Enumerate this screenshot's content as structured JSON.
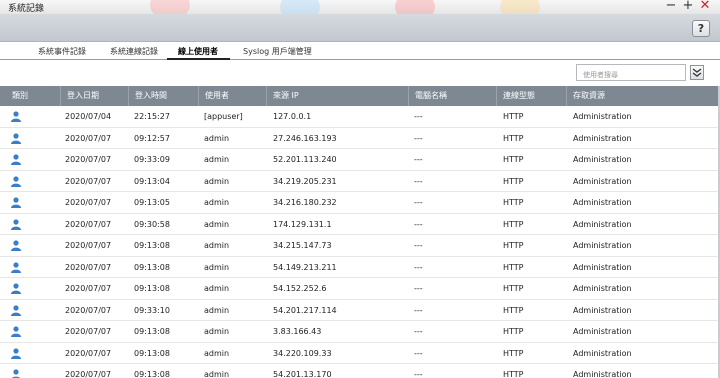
{
  "window": {
    "title": "系統記錄"
  },
  "tabs": [
    {
      "label": "系統事件記錄"
    },
    {
      "label": "系統連線記錄"
    },
    {
      "label": "線上使用者"
    },
    {
      "label": "Syslog 用戶端管理"
    }
  ],
  "help_label": "?",
  "search": {
    "placeholder": "使用者搜尋"
  },
  "filter_icon": "double-chevron-down-icon",
  "columns": [
    "類別",
    "登入日期",
    "登入時間",
    "使用者",
    "來源 IP",
    "電腦名稱",
    "連線型態",
    "存取資源"
  ],
  "rows": [
    {
      "date": "2020/07/04",
      "time": "22:15:27",
      "user": "[appuser]",
      "ip": "127.0.0.1",
      "computer": "---",
      "type": "HTTP",
      "resource": "Administration"
    },
    {
      "date": "2020/07/07",
      "time": "09:12:57",
      "user": "admin",
      "ip": "27.246.163.193",
      "computer": "---",
      "type": "HTTP",
      "resource": "Administration"
    },
    {
      "date": "2020/07/07",
      "time": "09:33:09",
      "user": "admin",
      "ip": "52.201.113.240",
      "computer": "---",
      "type": "HTTP",
      "resource": "Administration"
    },
    {
      "date": "2020/07/07",
      "time": "09:13:04",
      "user": "admin",
      "ip": "34.219.205.231",
      "computer": "---",
      "type": "HTTP",
      "resource": "Administration"
    },
    {
      "date": "2020/07/07",
      "time": "09:13:05",
      "user": "admin",
      "ip": "34.216.180.232",
      "computer": "---",
      "type": "HTTP",
      "resource": "Administration"
    },
    {
      "date": "2020/07/07",
      "time": "09:30:58",
      "user": "admin",
      "ip": "174.129.131.1",
      "computer": "---",
      "type": "HTTP",
      "resource": "Administration"
    },
    {
      "date": "2020/07/07",
      "time": "09:13:08",
      "user": "admin",
      "ip": "34.215.147.73",
      "computer": "---",
      "type": "HTTP",
      "resource": "Administration"
    },
    {
      "date": "2020/07/07",
      "time": "09:13:08",
      "user": "admin",
      "ip": "54.149.213.211",
      "computer": "---",
      "type": "HTTP",
      "resource": "Administration"
    },
    {
      "date": "2020/07/07",
      "time": "09:13:08",
      "user": "admin",
      "ip": "54.152.252.6",
      "computer": "---",
      "type": "HTTP",
      "resource": "Administration"
    },
    {
      "date": "2020/07/07",
      "time": "09:33:10",
      "user": "admin",
      "ip": "54.201.217.114",
      "computer": "---",
      "type": "HTTP",
      "resource": "Administration"
    },
    {
      "date": "2020/07/07",
      "time": "09:13:08",
      "user": "admin",
      "ip": "3.83.166.43",
      "computer": "---",
      "type": "HTTP",
      "resource": "Administration"
    },
    {
      "date": "2020/07/07",
      "time": "09:13:08",
      "user": "admin",
      "ip": "34.220.109.33",
      "computer": "---",
      "type": "HTTP",
      "resource": "Administration"
    },
    {
      "date": "2020/07/07",
      "time": "09:13:08",
      "user": "admin",
      "ip": "54.201.13.170",
      "computer": "---",
      "type": "HTTP",
      "resource": "Administration"
    }
  ],
  "colors": {
    "header_bg": "#7d8893",
    "icon_blue": "#3b7ec8",
    "close_red": "#d6212c"
  }
}
